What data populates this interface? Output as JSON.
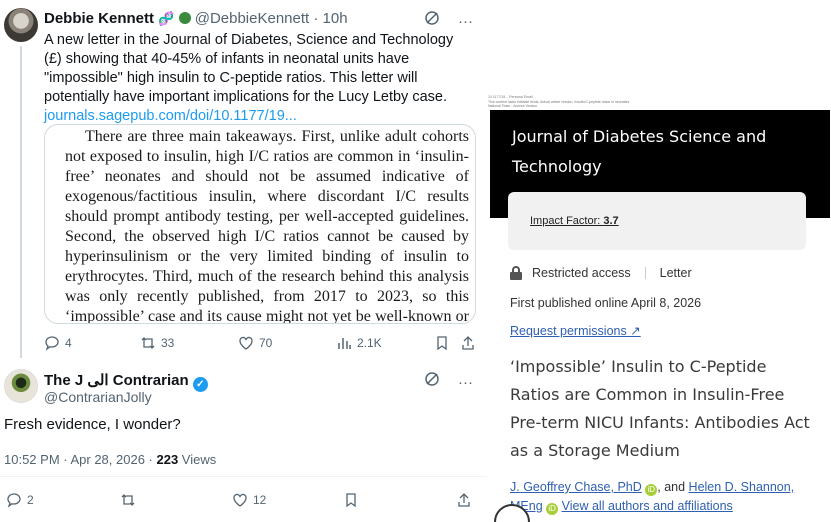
{
  "tweet1": {
    "name": "Debbie Kennett",
    "handle_time": "@DebbieKennett · 10h",
    "emoji": "🧬",
    "body": "A new letter in the Journal of Diabetes, Science and Technology (£) showing that 40-45% of infants in neonatal units have \"impossible\" high insulin to C-peptide ratios. This letter will potentially have important implications for the Lucy Letby case.",
    "link": "journals.sagepub.com/doi/10.1177/19...",
    "quote_image_text": "There are three main takeaways. First, unlike adult cohorts not exposed to insulin, high I/C ratios are common in ‘insulin-free’ neonates and should not be assumed indicative of exogenous/factitious insulin, where discordant I/C results should prompt antibody testing, per well-accepted guidelines. Second, the observed high I/C ratios cannot be caused by hyperinsulinism or the very limited binding of insulin to erythrocytes. Third, much of the research behind this analysis was only recently published, from 2017 to 2023, so this ‘impossible’ case and its cause might not yet be well-known or well-understood.",
    "replies": "4",
    "reposts": "33",
    "likes": "70",
    "views": "2.1K",
    "more_glyph": "···"
  },
  "tweet2": {
    "name": "The J الى Contrarian",
    "handle": "@ContrarianJolly",
    "body": "Fresh evidence, I wonder?",
    "time": "10:52 PM · Apr 28, 2026 · ",
    "views_count": "223",
    "views_label": " Views",
    "replies": "2",
    "likes": "12",
    "more_glyph": "···"
  },
  "journal": {
    "fine_print": "10.1177/19... Personal Email\nThis content lacks editable fields. Actual article version. Insulin/C-peptide ratios in neonates\nNational Team - Access Version",
    "banner_title": "Journal of Diabetes Science and Technology",
    "impact_label": "Impact Factor: ",
    "impact_value": "3.7",
    "access": "Restricted access",
    "type": "Letter",
    "published": "First published online April 8, 2026",
    "permissions": "Request permissions ↗",
    "article_title": "‘Impossible’ Insulin to C-Peptide Ratios are Common in Insulin-Free Pre-term NICU Infants: Antibodies Act as a Storage Medium",
    "author1": "J. Geoffrey Chase, PhD",
    "and": ", and ",
    "author2": "Helen D. Shannon, MEng",
    "view_all": "View all authors and affiliations",
    "orcid_glyph": "iD"
  },
  "colors": {
    "link_blue": "#1d9bf0",
    "journal_link": "#2f5fb0",
    "banner_bg": "#000000"
  }
}
